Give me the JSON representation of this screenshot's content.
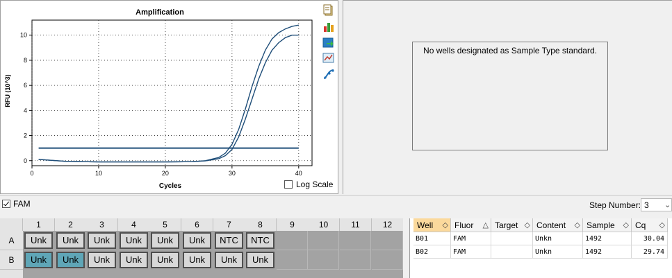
{
  "chart": {
    "title": "Amplification",
    "xlabel": "Cycles",
    "ylabel": "RFU (10^3)",
    "log_scale_label": "Log Scale",
    "log_scale_checked": false
  },
  "chart_data": {
    "type": "line",
    "title": "Amplification",
    "xlabel": "Cycles",
    "ylabel": "RFU (10^3)",
    "xlim": [
      0,
      42
    ],
    "ylim": [
      -0.4,
      11.2
    ],
    "xticks": [
      0,
      10,
      20,
      30,
      40
    ],
    "yticks": [
      0,
      2,
      4,
      6,
      8,
      10
    ],
    "grid": true,
    "threshold": 1.0,
    "series": [
      {
        "x": [
          1,
          5,
          10,
          15,
          20,
          24,
          26,
          28,
          29,
          30,
          31,
          32,
          33,
          34,
          35,
          36,
          37,
          38,
          39,
          40
        ],
        "y": [
          0.1,
          -0.05,
          -0.1,
          -0.1,
          -0.1,
          -0.08,
          0.0,
          0.25,
          0.6,
          1.3,
          2.5,
          4.1,
          5.9,
          7.5,
          8.8,
          9.7,
          10.2,
          10.5,
          10.7,
          10.8
        ]
      },
      {
        "x": [
          1,
          5,
          10,
          15,
          20,
          24,
          26,
          28,
          29,
          30,
          31,
          32,
          33,
          34,
          35,
          36,
          37,
          38,
          39,
          40
        ],
        "y": [
          0.1,
          -0.05,
          -0.1,
          -0.1,
          -0.1,
          -0.08,
          -0.02,
          0.15,
          0.4,
          0.9,
          1.9,
          3.3,
          4.9,
          6.5,
          7.8,
          8.8,
          9.4,
          9.8,
          10.0,
          10.0
        ]
      }
    ]
  },
  "toolbar": {
    "icons": [
      "copy-icon",
      "bar-chart-icon",
      "export-icon",
      "zoom-chart-icon",
      "curve-icon"
    ]
  },
  "std_panel": {
    "message": "No wells designated as Sample Type standard."
  },
  "fluor": {
    "label": "FAM",
    "checked": true
  },
  "step": {
    "label": "Step Number:",
    "value": "3"
  },
  "plate": {
    "columns": [
      "1",
      "2",
      "3",
      "4",
      "5",
      "6",
      "7",
      "8",
      "9",
      "10",
      "11",
      "12"
    ],
    "rows": [
      {
        "label": "A",
        "wells": [
          "Unk",
          "Unk",
          "Unk",
          "Unk",
          "Unk",
          "Unk",
          "NTC",
          "NTC"
        ],
        "selected": [
          false,
          false,
          false,
          false,
          false,
          false,
          false,
          false
        ]
      },
      {
        "label": "B",
        "wells": [
          "Unk",
          "Unk",
          "Unk",
          "Unk",
          "Unk",
          "Unk",
          "Unk",
          "Unk"
        ],
        "selected": [
          true,
          true,
          false,
          false,
          false,
          false,
          false,
          false
        ]
      }
    ]
  },
  "results": {
    "headers": [
      "Well",
      "Fluor",
      "Target",
      "Content",
      "Sample",
      "Cq"
    ],
    "sorted_column": "Well",
    "rows": [
      [
        "B01",
        "FAM",
        "",
        "Unkn",
        "1492",
        "30.04"
      ],
      [
        "B02",
        "FAM",
        "",
        "Unkn",
        "1492",
        "29.74"
      ]
    ]
  },
  "colors": {
    "curve": "#1f4e79",
    "threshold": "#1f4e79",
    "selected_well": "#5fa6b7",
    "sorted_header": "#fbd99c"
  }
}
